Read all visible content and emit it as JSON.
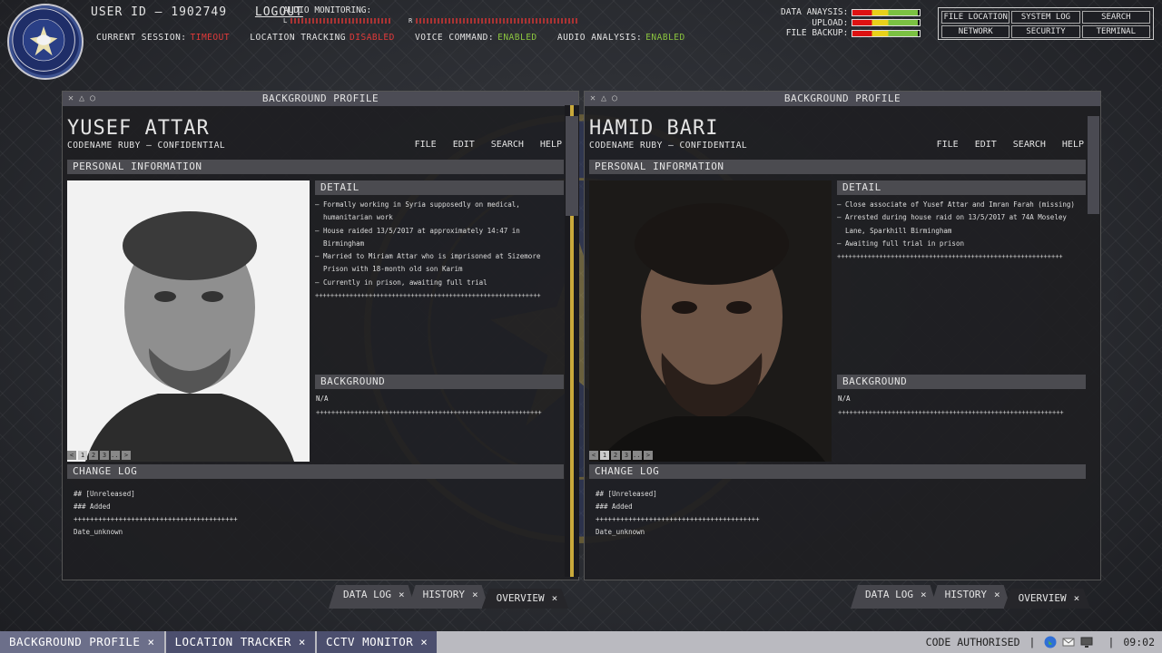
{
  "header": {
    "user_id": "USER ID – 1902749",
    "logout": "LOGOUT",
    "audio_label": "AUDIO MONITORING:",
    "audio_left": "L",
    "audio_right": "R",
    "session": [
      {
        "key": "CURRENT SESSION:",
        "value": "TIMEOUT",
        "color": "#e23a3a"
      },
      {
        "key": "LOCATION TRACKING",
        "value": "DISABLED",
        "color": "#e23a3a"
      },
      {
        "key": "VOICE COMMAND:",
        "value": "ENABLED",
        "color": "#8cc63f"
      },
      {
        "key": "AUDIO ANALYSIS:",
        "value": "ENABLED",
        "color": "#8cc63f"
      }
    ],
    "status": [
      {
        "label": "DATA ANAYSIS:",
        "level": 0.97
      },
      {
        "label": "UPLOAD:",
        "level": 0.97
      },
      {
        "label": "FILE BACKUP:",
        "level": 0.97
      }
    ],
    "menu": [
      "FILE LOCATION",
      "SYSTEM LOG",
      "SEARCH",
      "NETWORK",
      "SECURITY",
      "TERMINAL"
    ]
  },
  "panels": [
    {
      "window_title": "BACKGROUND PROFILE",
      "name": "YUSEF ATTAR",
      "codename": "CODENAME RUBY – CONFIDENTIAL",
      "menu": [
        "FILE",
        "EDIT",
        "SEARCH",
        "HELP"
      ],
      "personal_info": "PERSONAL INFORMATION",
      "detail_title": "DETAIL",
      "details": [
        "– Formally working in Syria supposedly on medical, humanitarian work",
        "– House raided 13/5/2017 at approximately 14:47 in Birmingham",
        "– Married to Miriam Attar who is imprisoned at Sizemore Prison with 18-month old son Karim",
        "– Currently in prison, awaiting full trial"
      ],
      "divider": "+++++++++++++++++++++++++++++++++++++++++++++++++++++++++++",
      "background_title": "BACKGROUND",
      "background_text": "N/A",
      "pager": [
        "<",
        "1",
        "2",
        "3",
        "...",
        ">"
      ],
      "changelog_title": "CHANGE LOG",
      "changelog": [
        "## [Unreleased]",
        "### Added",
        "++++++++++++++++++++++++++++++++++++++++",
        "Date_unknown"
      ]
    },
    {
      "window_title": "BACKGROUND PROFILE",
      "name": "HAMID BARI",
      "codename": "CODENAME RUBY – CONFIDENTIAL",
      "menu": [
        "FILE",
        "EDIT",
        "SEARCH",
        "HELP"
      ],
      "personal_info": "PERSONAL INFORMATION",
      "detail_title": "DETAIL",
      "details": [
        "– Close associate of Yusef Attar and Imran Farah (missing)",
        "– Arrested during house raid on 13/5/2017 at 74A Moseley Lane, Sparkhill Birmingham",
        "– Awaiting full trial in prison"
      ],
      "divider": "+++++++++++++++++++++++++++++++++++++++++++++++++++++++++++",
      "background_title": "BACKGROUND",
      "background_text": "N/A",
      "pager": [
        "<",
        "1",
        "2",
        "3",
        "...",
        ">"
      ],
      "changelog_title": "CHANGE LOG",
      "changelog": [
        "## [Unreleased]",
        "### Added",
        "++++++++++++++++++++++++++++++++++++++++",
        "Date_unknown"
      ]
    }
  ],
  "left_tabs": [
    "DATA LOG",
    "HISTORY",
    "OVERVIEW"
  ],
  "right_tabs": [
    "DATA LOG",
    "HISTORY",
    "OVERVIEW"
  ],
  "taskbar": {
    "tabs": [
      "BACKGROUND PROFILE",
      "LOCATION TRACKER",
      "CCTV MONITOR"
    ],
    "close": "×",
    "status": "CODE AUTHORISED",
    "time": "09:02"
  },
  "icons": {
    "window_controls": "close-minimize-restore-icons",
    "tray": [
      "globe-icon",
      "envelope-icon",
      "monitor-icon"
    ]
  }
}
